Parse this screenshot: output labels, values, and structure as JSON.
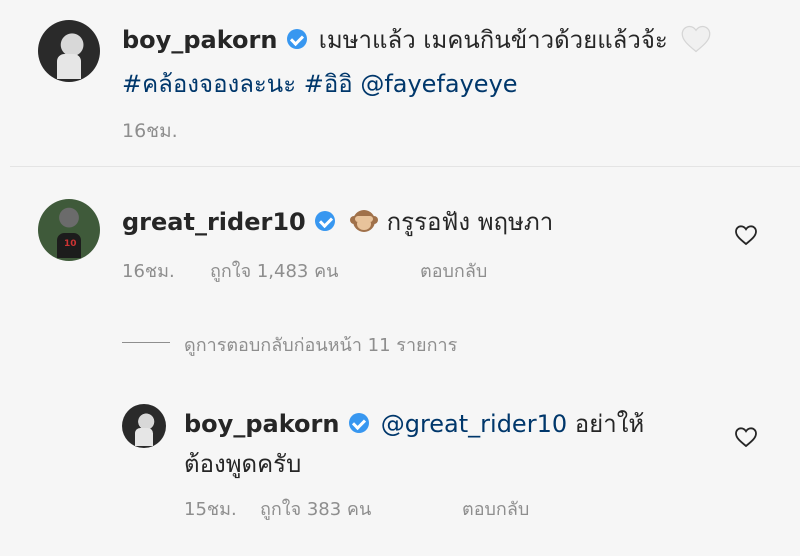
{
  "caption": {
    "username": "boy_pakorn",
    "text": "เมษาแล้ว เมคนกินข้าวด้วยแล้วจ้ะ",
    "emoji": "white-heart",
    "hashtag1": "#คล้องจองละนะ",
    "hashtag2": "#อิอิ",
    "mention": "@fayefayeye",
    "time": "16ชม."
  },
  "comment": {
    "username": "great_rider10",
    "emoji": "see-no-evil-monkey",
    "text": "กรูรอฟัง พฤษภา",
    "time": "16ชม.",
    "likes": "ถูกใจ 1,483 คน",
    "reply_label": "ตอบกลับ"
  },
  "view_replies": "ดูการตอบกลับก่อนหน้า 11 รายการ",
  "reply": {
    "username": "boy_pakorn",
    "mention": "@great_rider10",
    "text_line1": "อย่าให้",
    "text_line2": "ต้องพูดครับ",
    "time": "15ชม.",
    "likes": "ถูกใจ 383 คน",
    "reply_label": "ตอบกลับ"
  },
  "colors": {
    "background": "#f6f6f6",
    "link": "#00376b",
    "meta": "#8e8e8e",
    "verified": "#3897f0"
  }
}
